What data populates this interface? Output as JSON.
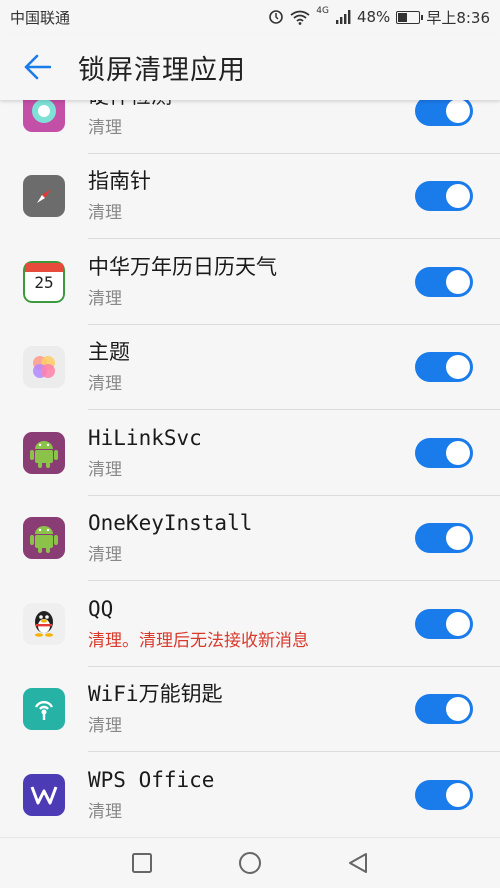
{
  "status": {
    "carrier": "中国联通",
    "signal_label": "4G",
    "battery": "48%",
    "battery_level": 0.48,
    "time": "早上8:36"
  },
  "header": {
    "title": "锁屏清理应用"
  },
  "apps": [
    {
      "name": "硬件检测",
      "sub": "清理",
      "warn": false,
      "icon": "hardware-check-icon",
      "enabled": true
    },
    {
      "name": "指南针",
      "sub": "清理",
      "warn": false,
      "icon": "compass-icon",
      "enabled": true
    },
    {
      "name": "中华万年历日历天气",
      "sub": "清理",
      "warn": false,
      "icon": "calendar-icon",
      "icon_text": "25",
      "enabled": true
    },
    {
      "name": "主题",
      "sub": "清理",
      "warn": false,
      "icon": "themes-icon",
      "enabled": true
    },
    {
      "name": "HiLinkSvc",
      "sub": "清理",
      "warn": false,
      "icon": "android-icon",
      "enabled": true
    },
    {
      "name": "OneKeyInstall",
      "sub": "清理",
      "warn": false,
      "icon": "android-icon",
      "enabled": true
    },
    {
      "name": "QQ",
      "sub": "清理。清理后无法接收新消息",
      "warn": true,
      "icon": "qq-penguin-icon",
      "enabled": true
    },
    {
      "name": "WiFi万能钥匙",
      "sub": "清理",
      "warn": false,
      "icon": "wifi-key-icon",
      "enabled": true
    },
    {
      "name": "WPS Office",
      "sub": "清理",
      "warn": false,
      "icon": "wps-icon",
      "enabled": true
    }
  ],
  "nav": {
    "recent": "square-icon",
    "home": "circle-icon",
    "back": "triangle-back-icon"
  },
  "colors": {
    "accent": "#1a7bea",
    "warning": "#d93a2c"
  }
}
